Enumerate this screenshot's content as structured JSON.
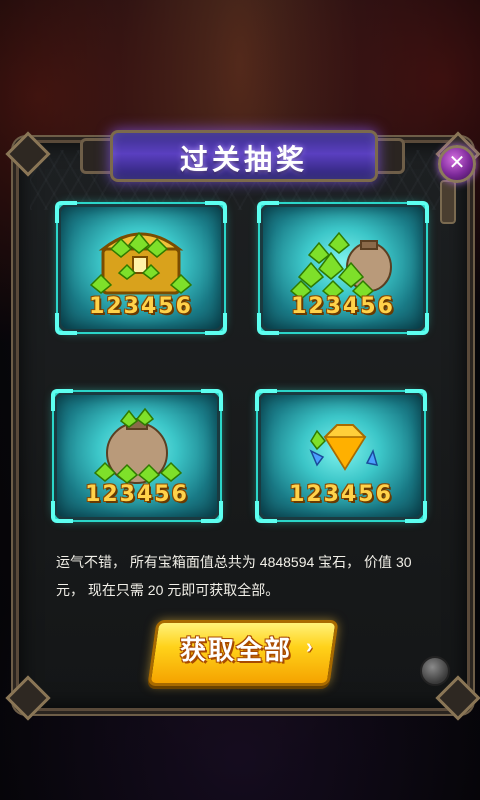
{
  "dialog": {
    "title": "过关抽奖",
    "close_icon": "close-x-icon"
  },
  "rewards": [
    {
      "amount": "123456",
      "icon": "treasure-chest-gems-icon"
    },
    {
      "amount": "123456",
      "icon": "gem-pile-bag-icon"
    },
    {
      "amount": "123456",
      "icon": "gem-sack-icon"
    },
    {
      "amount": "123456",
      "icon": "diamond-crystals-icon"
    }
  ],
  "description": "运气不错， 所有宝箱面值总共为 4848594 宝石， 价值 30 元， 现在只需 20 元即可获取全部。",
  "claim_button": {
    "label": "获取全部",
    "arrow": "›"
  },
  "colors": {
    "accent": "#ffd24a",
    "card": "#3cc6c8",
    "title": "#5a3fc0",
    "button": "#ffd21a"
  }
}
